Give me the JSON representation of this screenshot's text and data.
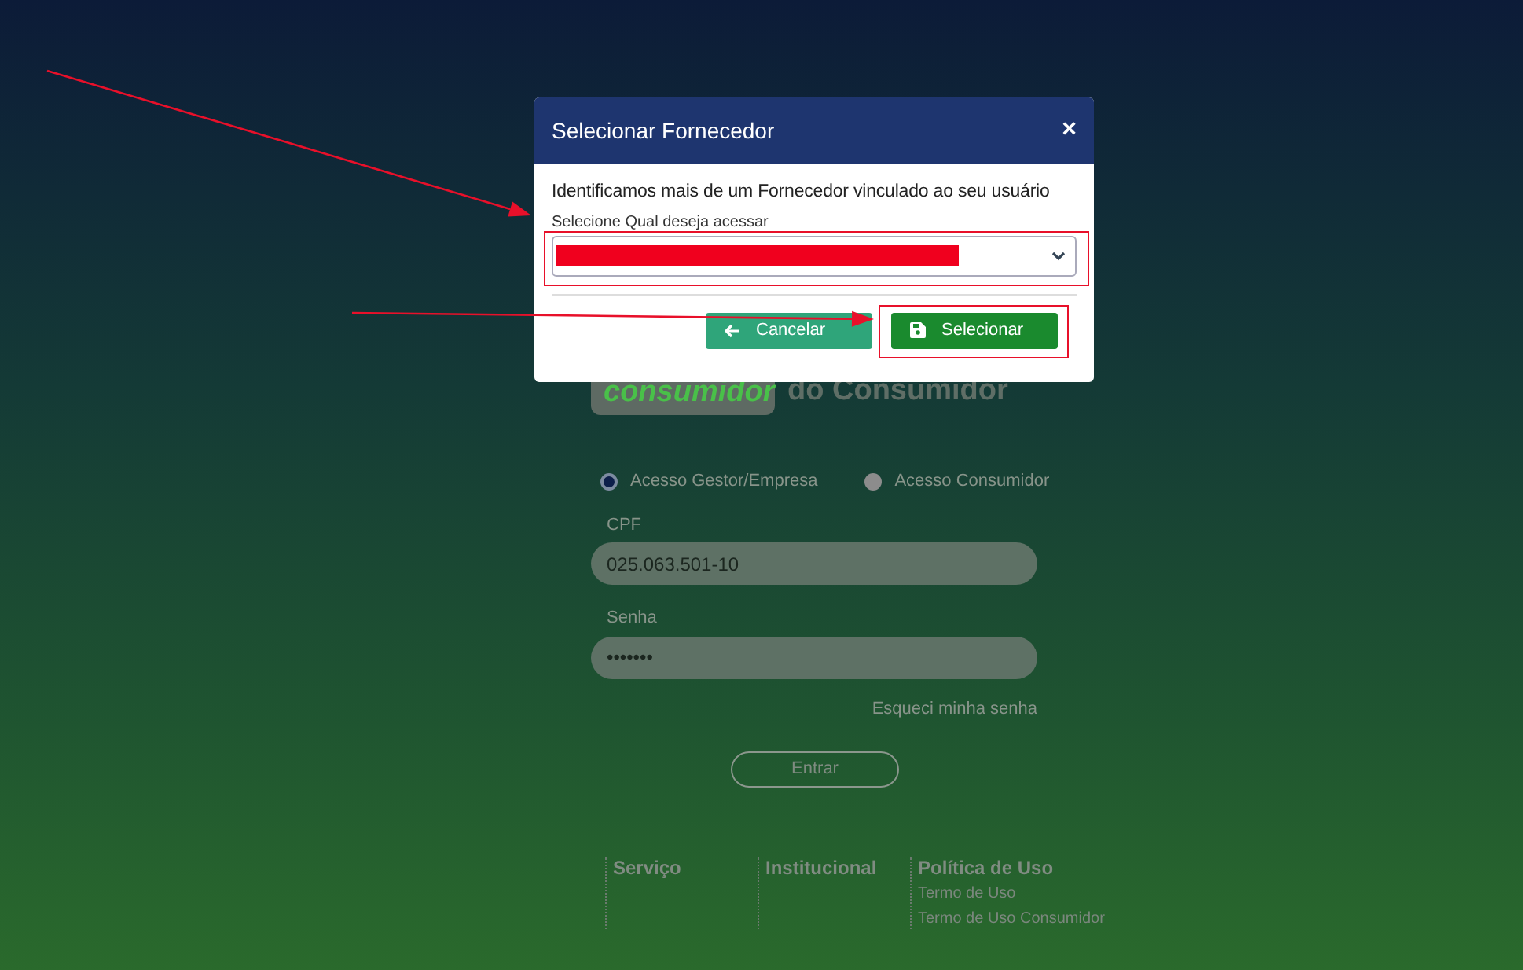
{
  "background": {
    "logo_text": "consumidor",
    "brand_text": "do Consumidor",
    "access_options": [
      {
        "label": "Acesso Gestor/Empresa",
        "selected": true
      },
      {
        "label": "Acesso Consumidor",
        "selected": false
      }
    ],
    "fields": [
      {
        "label": "CPF",
        "value": "025.063.501-10"
      },
      {
        "label": "Senha",
        "value": "•••••••"
      }
    ],
    "forgot_link": "Esqueci minha senha",
    "submit_button": "Entrar",
    "footer": [
      {
        "heading": "Serviço"
      },
      {
        "heading": "Institucional"
      },
      {
        "heading": "Política de Uso",
        "links": [
          "Termo de Uso",
          "Termo de Uso Consumidor"
        ]
      }
    ]
  },
  "modal": {
    "title": "Selecionar Fornecedor",
    "close": "×",
    "message": "Identificamos mais de um Fornecedor vinculado ao seu usuário",
    "select_label": "Selecione Qual deseja acessar",
    "select_redacted": true,
    "buttons": [
      {
        "kind": "cancel",
        "label": "Cancelar"
      },
      {
        "kind": "confirm",
        "label": "Selecionar"
      }
    ]
  },
  "annotations": {
    "show_arrows": true,
    "highlight_select": true,
    "highlight_confirm": true
  }
}
